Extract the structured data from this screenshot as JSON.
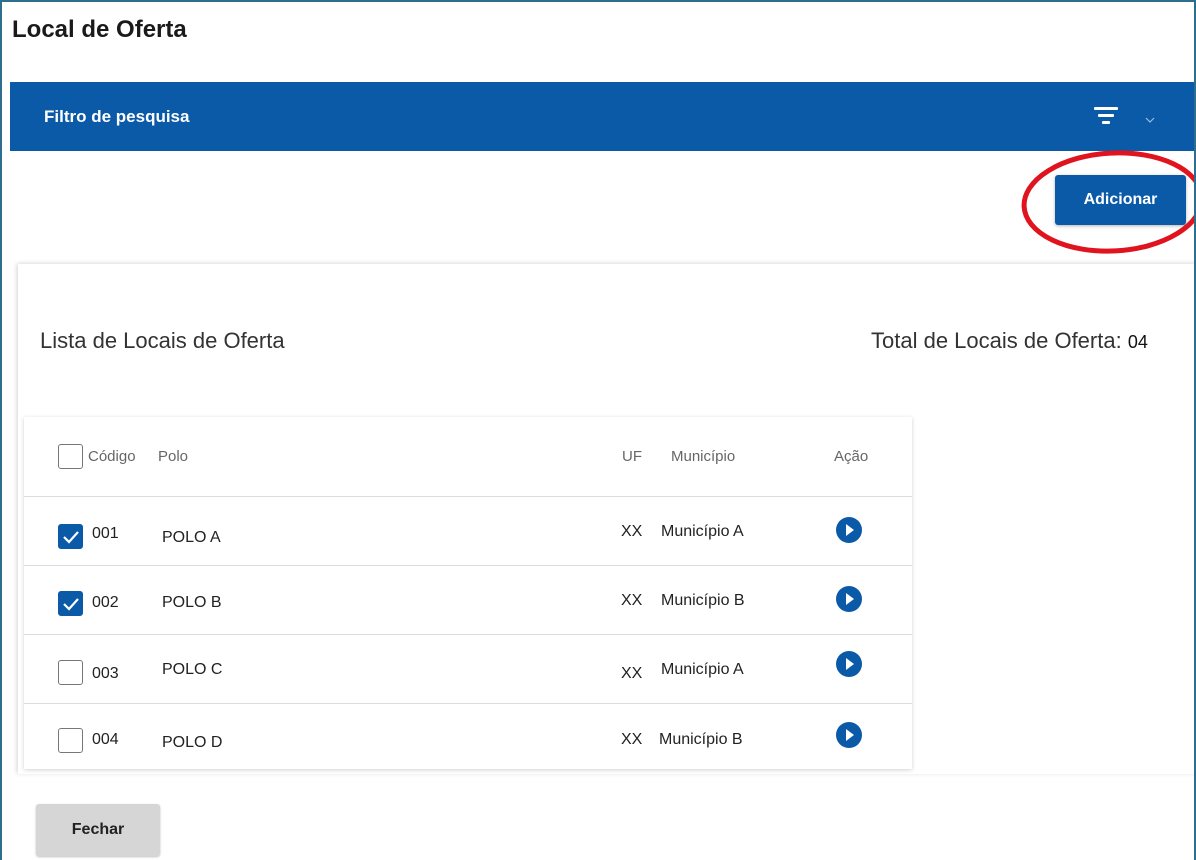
{
  "page": {
    "title": "Local de Oferta"
  },
  "filter": {
    "title": "Filtro de pesquisa",
    "icon": "filter-icon",
    "toggle_icon": "chevron-down-icon"
  },
  "toolbar": {
    "add_label": "Adicionar"
  },
  "list": {
    "title": "Lista de Locais de Oferta",
    "total_label": "Total de Locais de Oferta:",
    "total_value": "04"
  },
  "table": {
    "headers": {
      "code": "Código",
      "polo": "Polo",
      "uf": "UF",
      "municipio": "Município",
      "acao": "Ação"
    },
    "rows": [
      {
        "code": "001",
        "polo": "POLO A",
        "uf": "XX",
        "municipio": "Município A",
        "checked": true
      },
      {
        "code": "002",
        "polo": "POLO B",
        "uf": "XX",
        "municipio": "Município B",
        "checked": true
      },
      {
        "code": "003",
        "polo": "POLO C",
        "uf": "XX",
        "municipio": "Município A",
        "checked": false
      },
      {
        "code": "004",
        "polo": "POLO D",
        "uf": "XX",
        "municipio": "Município B",
        "checked": false
      }
    ]
  },
  "footer": {
    "close_label": "Fechar"
  },
  "colors": {
    "primary": "#0a5aa8",
    "highlight": "#e0141e",
    "button_gray": "#d6d6d6"
  }
}
